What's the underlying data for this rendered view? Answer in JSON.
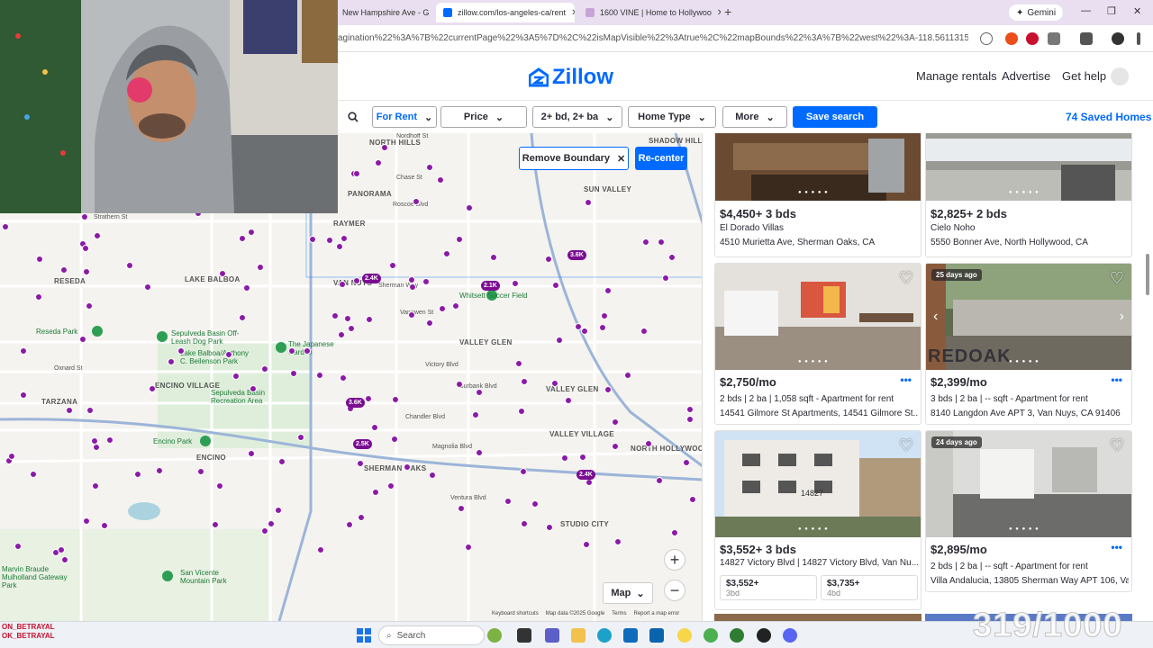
{
  "browser": {
    "tabs": [
      {
        "label": "New Hampshire Ave - G",
        "active": false
      },
      {
        "label": "zillow.com/los-angeles-ca/rent",
        "active": true
      },
      {
        "label": "1600 VINE | Home to Hollywoo",
        "active": false
      }
    ],
    "gemini_label": "Gemini",
    "url": "agination%22%3A%7B%22currentPage%22%3A5%7D%2C%22isMapVisible%22%3Atrue%2C%22mapBounds%22%3A%7B%22west%22%3A-118.56113151216714%2C%22east%22%3A-118.36028770113198..."
  },
  "header": {
    "logo": "Zillow",
    "nav": [
      "Manage rentals",
      "Advertise",
      "Get help"
    ]
  },
  "filters": {
    "listing_type": "For Rent",
    "price": "Price",
    "beds_baths": "2+ bd, 2+ ba",
    "home_type": "Home Type",
    "more": "More",
    "save_search": "Save search",
    "saved_homes": "74 Saved Homes"
  },
  "map": {
    "remove_boundary": "Remove Boundary",
    "recenter": "Re-center",
    "map_type": "Map",
    "footer": [
      "Keyboard shortcuts",
      "Map data ©2025 Google",
      "Terms",
      "Report a map error"
    ],
    "clusters": [
      "3.6K",
      "2.4K",
      "2.1K",
      "3.6K",
      "2.5K",
      "2.4K"
    ],
    "places": [
      "SHADOW HILL",
      "SUN VALLEY",
      "LAKE BALBOA",
      "VALLEY GLEN",
      "NORTH HOLLYWOOD",
      "ENCINO VILLAGE",
      "RESEDA",
      "TARZANA",
      "ENCINO",
      "SHERMAN OAKS",
      "STUDIO CITY",
      "VALLEY VILLAGE",
      "PANORAMA",
      "NORTH HILLS",
      "VAN NUYS",
      "RAYMER",
      "VALLEY GLEN"
    ],
    "streets": [
      "Nordhoff St",
      "Roscoe Blvd",
      "Vanowen St",
      "Victory Blvd",
      "Oxnard St",
      "Burbank Blvd",
      "Magnolia Blvd",
      "Ventura Blvd",
      "Chandler Blvd",
      "Strathern St",
      "Sherman Way",
      "Chase St"
    ],
    "parks": [
      "Whitsett Soccer Field",
      "Sepulveda Basin Off-Leash Dog Park",
      "The Japanese Garden",
      "Lake Balboa/Anthony C. Beilenson Park",
      "Reseda Park",
      "Encino Park",
      "Sepulveda Basin Recreation Area",
      "Marvin Braude Mulholland Gateway Park",
      "San Vicente Mountain Park"
    ]
  },
  "listings": [
    {
      "price": "$4,450+ 3 bds",
      "name": "El Dorado Villas",
      "address": "4510 Murietta Ave, Sherman Oaks, CA",
      "photo_color": "#6b4a32"
    },
    {
      "price": "$2,825+ 2 bds",
      "name": "Cielo Noho",
      "address": "5550 Bonner Ave, North Hollywood, CA",
      "photo_color": "#8c8c86"
    },
    {
      "price": "$2,750/mo",
      "details": "2 bds | 2 ba | 1,058 sqft - Apartment for rent",
      "address": "14541 Gilmore St Apartments, 14541 Gilmore St...",
      "photo_color": "#d9d6d1"
    },
    {
      "price": "$2,399/mo",
      "badge": "25 days ago",
      "details": "3 bds | 2 ba | -- sqft - Apartment for rent",
      "address": "8140 Langdon Ave APT 3, Van Nuys, CA 91406",
      "photo_color": "#5f6b4f",
      "watermark": "REDOAK"
    },
    {
      "price": "$3,552+ 3 bds",
      "address": "14827 Victory Blvd | 14827 Victory Blvd, Van Nu...",
      "units": [
        {
          "price": "$3,552+",
          "beds": "3bd"
        },
        {
          "price": "$3,735+",
          "beds": "4bd"
        }
      ],
      "photo_color": "#e6e3de",
      "sign": "14827"
    },
    {
      "price": "$2,895/mo",
      "badge": "24 days ago",
      "details": "2 bds | 2 ba | -- sqft - Apartment for rent",
      "address": "Villa Andalucia, 13805 Sherman Way APT 106, Va...",
      "photo_color": "#7a7a78"
    }
  ],
  "taskbar": {
    "search": "Search"
  },
  "overlay": {
    "counter": "319/1000",
    "chat": [
      "ON_BETRAYAL",
      "OK_BETRAYAL"
    ]
  },
  "colors": {
    "zillow_blue": "#006aff",
    "pin_purple": "#8b1aa6"
  }
}
